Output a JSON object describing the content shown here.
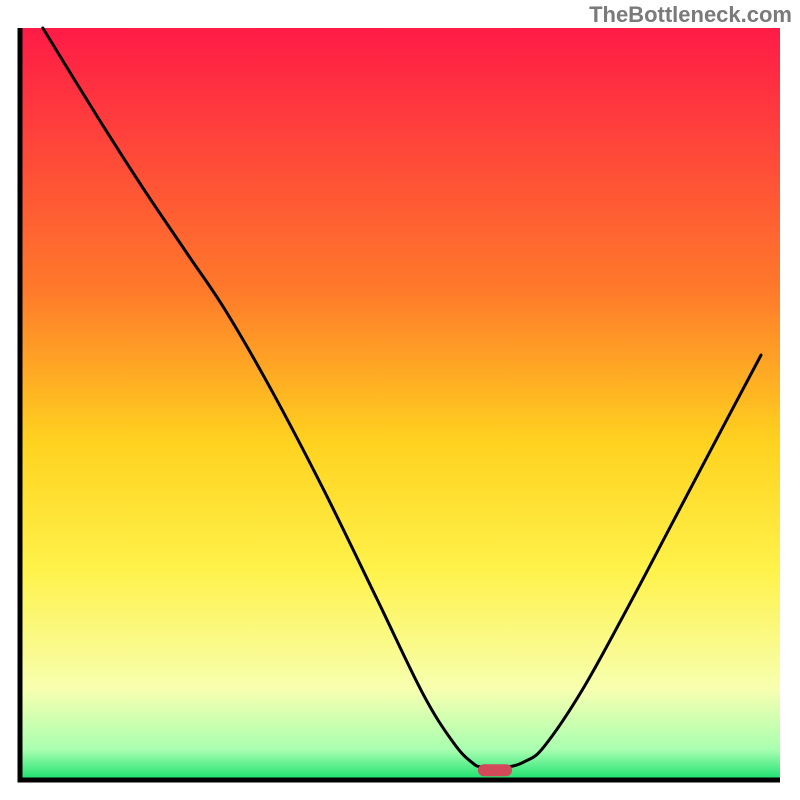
{
  "watermark": "TheBottleneck.com",
  "chart_data": {
    "type": "line",
    "title": "",
    "xlabel": "",
    "ylabel": "",
    "xlim": [
      0,
      100
    ],
    "ylim": [
      0,
      100
    ],
    "gradient_stops": [
      {
        "offset": 0,
        "color": "#ff1b47"
      },
      {
        "offset": 35,
        "color": "#ff7a2a"
      },
      {
        "offset": 55,
        "color": "#ffd21f"
      },
      {
        "offset": 72,
        "color": "#fff24a"
      },
      {
        "offset": 88,
        "color": "#f7ffb0"
      },
      {
        "offset": 96,
        "color": "#a8ffb0"
      },
      {
        "offset": 100,
        "color": "#18e06e"
      }
    ],
    "series": [
      {
        "name": "bottleneck-curve",
        "color": "#000000",
        "points": [
          {
            "x": 3.0,
            "y": 100.0
          },
          {
            "x": 10.0,
            "y": 88.5
          },
          {
            "x": 16.0,
            "y": 79.0
          },
          {
            "x": 22.0,
            "y": 70.0
          },
          {
            "x": 27.0,
            "y": 62.5
          },
          {
            "x": 33.0,
            "y": 52.0
          },
          {
            "x": 40.0,
            "y": 38.5
          },
          {
            "x": 47.0,
            "y": 24.0
          },
          {
            "x": 53.0,
            "y": 11.5
          },
          {
            "x": 57.0,
            "y": 5.0
          },
          {
            "x": 59.5,
            "y": 2.3
          },
          {
            "x": 61.0,
            "y": 1.7
          },
          {
            "x": 64.0,
            "y": 1.7
          },
          {
            "x": 66.5,
            "y": 2.5
          },
          {
            "x": 69.0,
            "y": 4.5
          },
          {
            "x": 74.0,
            "y": 12.0
          },
          {
            "x": 80.0,
            "y": 23.0
          },
          {
            "x": 86.0,
            "y": 34.5
          },
          {
            "x": 92.0,
            "y": 46.0
          },
          {
            "x": 97.5,
            "y": 56.5
          }
        ]
      }
    ],
    "marker": {
      "name": "optimal-marker",
      "x": 62.5,
      "y": 1.3,
      "width": 4.5,
      "height": 1.6,
      "color": "#d24a5a"
    },
    "axes": {
      "color": "#000000",
      "thickness": 5
    }
  }
}
